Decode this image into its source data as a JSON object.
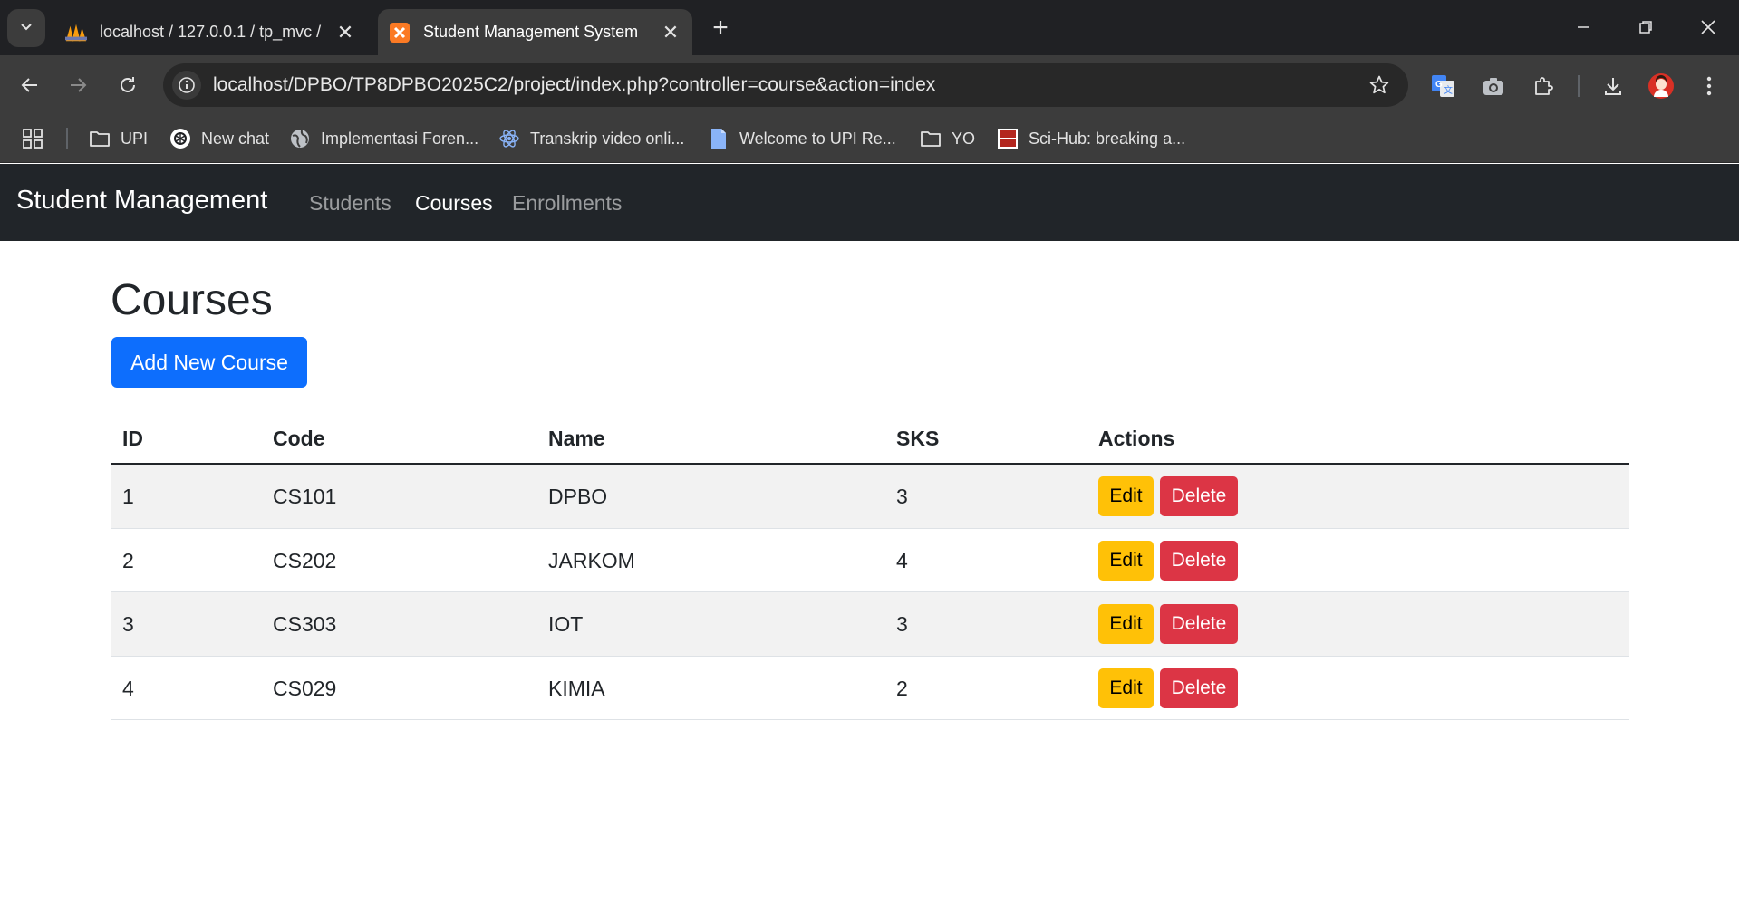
{
  "browser": {
    "tabs": [
      {
        "title": "localhost / 127.0.0.1 / tp_mvc /",
        "active": false,
        "icon": "phpmyadmin-icon"
      },
      {
        "title": "Student Management System",
        "active": true,
        "icon": "xampp-icon"
      }
    ],
    "url": "localhost/DPBO/TP8DPBO2025C2/project/index.php?controller=course&action=index",
    "bookmarks": [
      {
        "label": "UPI",
        "icon": "folder-icon"
      },
      {
        "label": "New chat",
        "icon": "openai-icon"
      },
      {
        "label": "Implementasi Foren...",
        "icon": "globe-icon"
      },
      {
        "label": "Transkrip video onli...",
        "icon": "react-icon"
      },
      {
        "label": "Welcome to UPI Re...",
        "icon": "document-icon"
      },
      {
        "label": "YO",
        "icon": "folder-icon"
      },
      {
        "label": "Sci-Hub: breaking a...",
        "icon": "scihub-icon"
      }
    ]
  },
  "navbar": {
    "brand": "Student Management",
    "links": [
      {
        "label": "Students",
        "active": false
      },
      {
        "label": "Courses",
        "active": true
      },
      {
        "label": "Enrollments",
        "active": false
      }
    ]
  },
  "page": {
    "title": "Courses",
    "add_button": "Add New Course"
  },
  "table": {
    "headers": [
      "ID",
      "Code",
      "Name",
      "SKS",
      "Actions"
    ],
    "rows": [
      {
        "id": "1",
        "code": "CS101",
        "name": "DPBO",
        "sks": "3"
      },
      {
        "id": "2",
        "code": "CS202",
        "name": "JARKOM",
        "sks": "4"
      },
      {
        "id": "3",
        "code": "CS303",
        "name": "IOT",
        "sks": "3"
      },
      {
        "id": "4",
        "code": "CS029",
        "name": "KIMIA",
        "sks": "2"
      }
    ],
    "edit_label": "Edit",
    "delete_label": "Delete"
  },
  "colors": {
    "primary": "#0d6efd",
    "warning": "#ffc107",
    "danger": "#dc3545",
    "navbar_bg": "#212529"
  }
}
